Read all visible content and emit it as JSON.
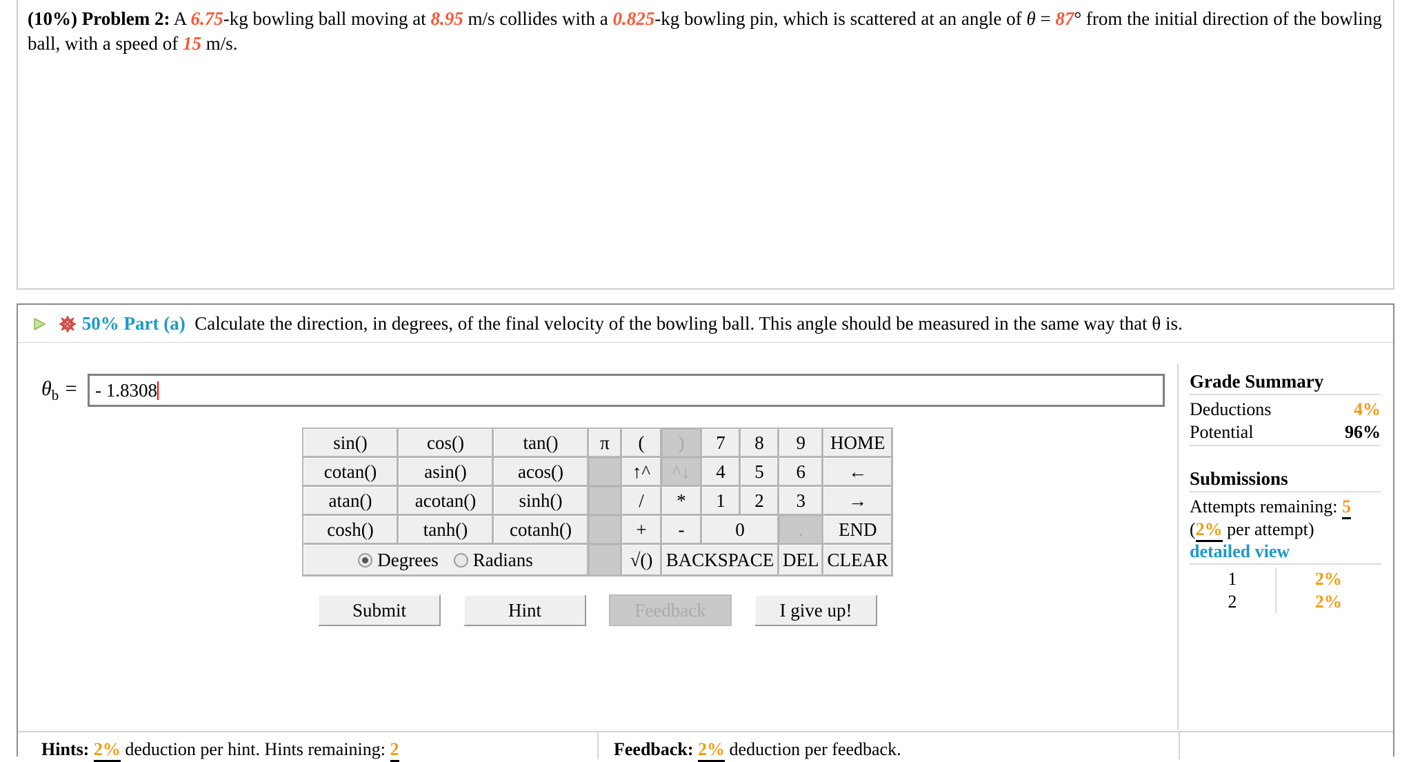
{
  "problem": {
    "weight": "(10%)",
    "label": "Problem 2:",
    "text_1": " A ",
    "mass_ball": "6.75",
    "text_2": "-kg bowling ball moving at ",
    "speed_ball": "8.95",
    "text_3": " m/s collides with a ",
    "mass_pin": "0.825",
    "text_4": "-kg bowling pin, which is scattered at an angle of ",
    "theta_symbol": "θ",
    "equals": " = ",
    "angle": "87",
    "degree": "°",
    "text_5": " from the initial direction of the bowling ball, with a speed of ",
    "speed_pin": "15",
    "text_6": " m/s."
  },
  "part": {
    "expand_icon": "expand-triangle-icon",
    "status_icon": "incorrect-x-icon",
    "title": "50% Part (a)",
    "prompt": "Calculate the direction, in degrees, of the final velocity of the bowling ball. This angle should be measured in the same way that θ is."
  },
  "answer": {
    "label_main": "θ",
    "label_sub": "b",
    "label_equals": "=",
    "value": "- 1.8308",
    "placeholder": ""
  },
  "keypad": {
    "rows": [
      [
        {
          "label": "sin()",
          "cls": "k-fn",
          "state": "enabled",
          "name": "key-sin"
        },
        {
          "label": "cos()",
          "cls": "k-fn",
          "state": "enabled",
          "name": "key-cos"
        },
        {
          "label": "tan()",
          "cls": "k-fn",
          "state": "enabled",
          "name": "key-tan"
        },
        {
          "label": "π",
          "cls": "k-pi",
          "state": "enabled",
          "name": "key-pi"
        },
        {
          "label": "(",
          "cls": "k-op",
          "state": "enabled",
          "name": "key-open-paren"
        },
        {
          "label": ")",
          "cls": "k-op",
          "state": "disabled",
          "name": "key-close-paren"
        },
        {
          "label": "7",
          "cls": "k-num",
          "state": "enabled",
          "name": "key-7"
        },
        {
          "label": "8",
          "cls": "k-num",
          "state": "enabled",
          "name": "key-8"
        },
        {
          "label": "9",
          "cls": "k-num",
          "state": "enabled",
          "name": "key-9"
        },
        {
          "label": "HOME",
          "cls": "k-nav",
          "state": "enabled",
          "name": "key-home"
        }
      ],
      [
        {
          "label": "cotan()",
          "cls": "k-fn",
          "state": "enabled",
          "name": "key-cotan"
        },
        {
          "label": "asin()",
          "cls": "k-fn",
          "state": "enabled",
          "name": "key-asin"
        },
        {
          "label": "acos()",
          "cls": "k-fn",
          "state": "enabled",
          "name": "key-acos"
        },
        {
          "label": "",
          "cls": "k-pi",
          "state": "blank",
          "name": "key-blank-1"
        },
        {
          "label": "↑^",
          "cls": "k-op",
          "state": "enabled",
          "name": "key-power-up"
        },
        {
          "label": "^↓",
          "cls": "k-op",
          "state": "disabled",
          "name": "key-power-down"
        },
        {
          "label": "4",
          "cls": "k-num",
          "state": "enabled",
          "name": "key-4"
        },
        {
          "label": "5",
          "cls": "k-num",
          "state": "enabled",
          "name": "key-5"
        },
        {
          "label": "6",
          "cls": "k-num",
          "state": "enabled",
          "name": "key-6"
        },
        {
          "label": "←",
          "cls": "k-nav",
          "state": "enabled",
          "name": "key-arrow-left"
        }
      ],
      [
        {
          "label": "atan()",
          "cls": "k-fn",
          "state": "enabled",
          "name": "key-atan"
        },
        {
          "label": "acotan()",
          "cls": "k-fn",
          "state": "enabled",
          "name": "key-acotan"
        },
        {
          "label": "sinh()",
          "cls": "k-fn",
          "state": "enabled",
          "name": "key-sinh"
        },
        {
          "label": "",
          "cls": "k-pi",
          "state": "blank",
          "name": "key-blank-2"
        },
        {
          "label": "/",
          "cls": "k-op",
          "state": "enabled",
          "name": "key-divide"
        },
        {
          "label": "*",
          "cls": "k-op",
          "state": "enabled",
          "name": "key-multiply"
        },
        {
          "label": "1",
          "cls": "k-num",
          "state": "enabled",
          "name": "key-1"
        },
        {
          "label": "2",
          "cls": "k-num",
          "state": "enabled",
          "name": "key-2"
        },
        {
          "label": "3",
          "cls": "k-num",
          "state": "enabled",
          "name": "key-3"
        },
        {
          "label": "→",
          "cls": "k-nav",
          "state": "enabled",
          "name": "key-arrow-right"
        }
      ]
    ],
    "row4": [
      {
        "label": "cosh()",
        "cls": "k-fn",
        "state": "enabled",
        "name": "key-cosh"
      },
      {
        "label": "tanh()",
        "cls": "k-fn",
        "state": "enabled",
        "name": "key-tanh"
      },
      {
        "label": "cotanh()",
        "cls": "k-fn",
        "state": "enabled",
        "name": "key-cotanh"
      },
      {
        "label": "",
        "cls": "k-pi",
        "state": "blank",
        "name": "key-blank-3"
      },
      {
        "label": "+",
        "cls": "k-op",
        "state": "enabled",
        "name": "key-plus"
      },
      {
        "label": "-",
        "cls": "k-op",
        "state": "enabled",
        "name": "key-minus"
      },
      {
        "label": "0",
        "cls": "k-num",
        "state": "enabled",
        "name": "key-0"
      },
      {
        "label": ".",
        "cls": "k-num",
        "state": "disabled",
        "name": "key-decimal"
      },
      {
        "label": "END",
        "cls": "k-nav",
        "state": "enabled",
        "name": "key-end"
      }
    ],
    "row5": [
      {
        "label": "",
        "cls": "k-pi",
        "state": "blank",
        "name": "key-blank-4"
      },
      {
        "label": "√()",
        "cls": "k-op",
        "state": "enabled",
        "name": "key-sqrt"
      },
      {
        "label": "BACKSPACE",
        "cls": "k-mid",
        "state": "enabled",
        "name": "key-backspace"
      },
      {
        "label": "DEL",
        "cls": "k-small",
        "state": "enabled",
        "name": "key-del"
      },
      {
        "label": "CLEAR",
        "cls": "k-nav",
        "state": "enabled",
        "name": "key-clear"
      }
    ],
    "angle_mode": {
      "degrees_label": "Degrees",
      "radians_label": "Radians",
      "selected": "Degrees"
    }
  },
  "actions": {
    "submit": "Submit",
    "hint": "Hint",
    "feedback": "Feedback",
    "give_up": "I give up!"
  },
  "grade_summary": {
    "heading": "Grade Summary",
    "deductions_label": "Deductions",
    "deductions_value": "4%",
    "potential_label": "Potential",
    "potential_value": "96%",
    "submissions_heading": "Submissions",
    "attempts_label": "Attempts remaining:",
    "attempts_value": "5",
    "per_attempt_open": "(",
    "per_attempt_value": "2%",
    "per_attempt_text": " per attempt)",
    "detailed_view": "detailed view",
    "submissions": [
      {
        "num": "1",
        "pct": "2%"
      },
      {
        "num": "2",
        "pct": "2%"
      }
    ]
  },
  "footer": {
    "hints_label": "Hints:",
    "hints_pct": "2%",
    "hints_text": " deduction per hint. Hints remaining:",
    "hints_remaining": "2",
    "feedback_label": "Feedback:",
    "feedback_pct": "2%",
    "feedback_text": " deduction per feedback."
  },
  "colors": {
    "accent_blue": "#1b9ac9",
    "value_red": "#ff5533",
    "orange": "#f59b14"
  }
}
